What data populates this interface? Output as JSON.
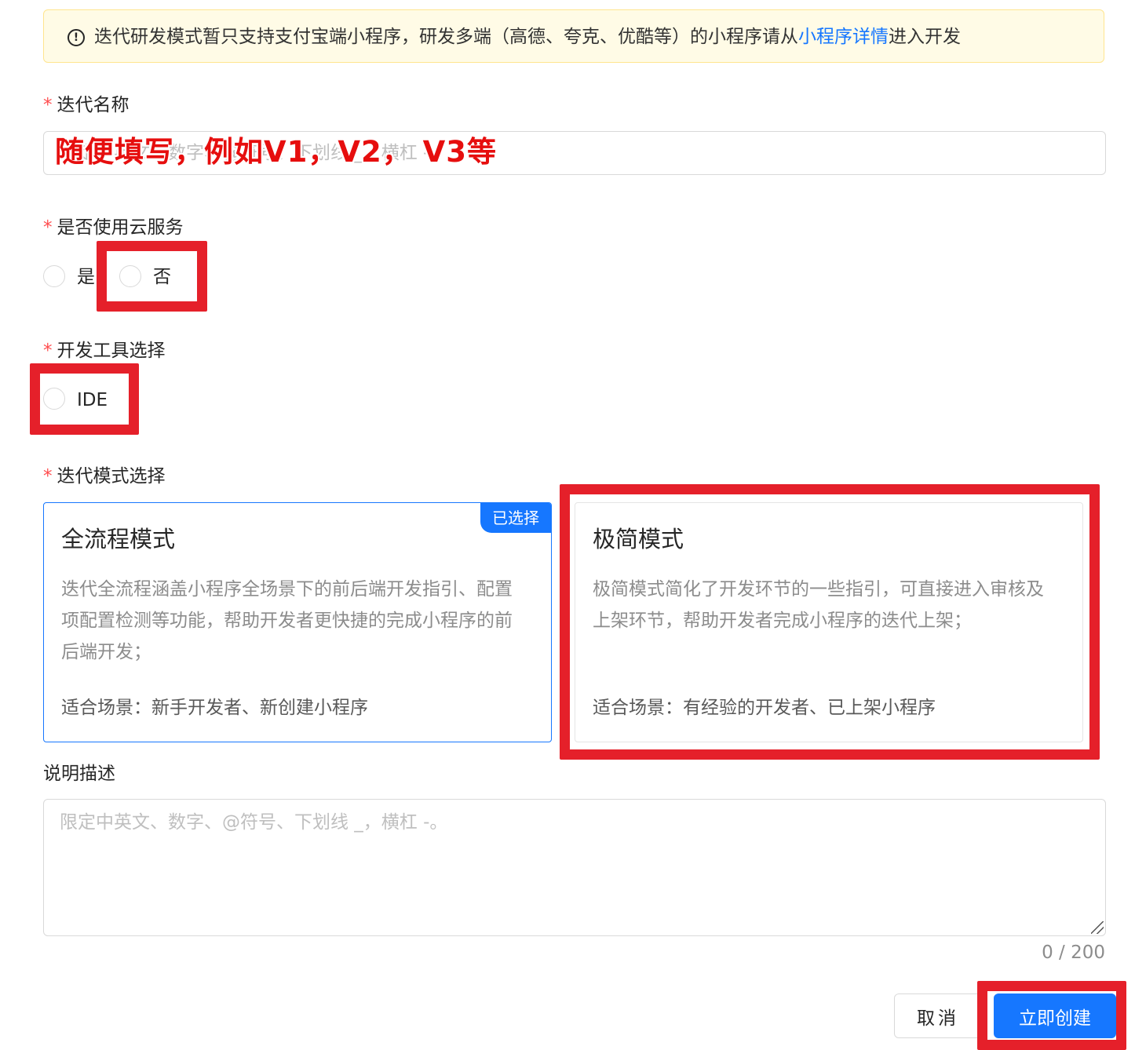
{
  "alert": {
    "icon": "exclamation-circle-icon",
    "text_before": "迭代研发模式暂只支持支付宝端小程序，研发多端（高德、夸克、优酷等）的小程序请从",
    "link": "小程序详情",
    "text_after": "进入开发"
  },
  "iteration_name": {
    "required_mark": "*",
    "label": "迭代名称",
    "placeholder": "限定中英文、数字、@符号、下划线 _，横杠 -。",
    "annotation": "随便填写，例如V1，V2， V3等"
  },
  "cloud_service": {
    "required_mark": "*",
    "label": "是否使用云服务",
    "options": [
      "是",
      "否"
    ]
  },
  "dev_tool": {
    "required_mark": "*",
    "label": "开发工具选择",
    "options": [
      "IDE"
    ]
  },
  "iteration_mode": {
    "required_mark": "*",
    "label": "迭代模式选择",
    "cards": [
      {
        "title": "全流程模式",
        "description": "迭代全流程涵盖小程序全场景下的前后端开发指引、配置项配置检测等功能，帮助开发者更快捷的完成小程序的前后端开发；",
        "scene": "适合场景：新手开发者、新创建小程序",
        "badge": "已选择"
      },
      {
        "title": "极简模式",
        "description": "极简模式简化了开发环节的一些指引，可直接进入审核及上架环节，帮助开发者完成小程序的迭代上架；",
        "scene": "适合场景：有经验的开发者、已上架小程序"
      }
    ]
  },
  "description": {
    "label": "说明描述",
    "placeholder": "限定中英文、数字、@符号、下划线 _，横杠 -。",
    "counter": "0 / 200"
  },
  "buttons": {
    "cancel": "取消",
    "create": "立即创建"
  },
  "colors": {
    "primary": "#1677ff",
    "annotation_red": "#e5202a",
    "alert_bg": "#fffbe6",
    "required": "#ff4d4f"
  }
}
